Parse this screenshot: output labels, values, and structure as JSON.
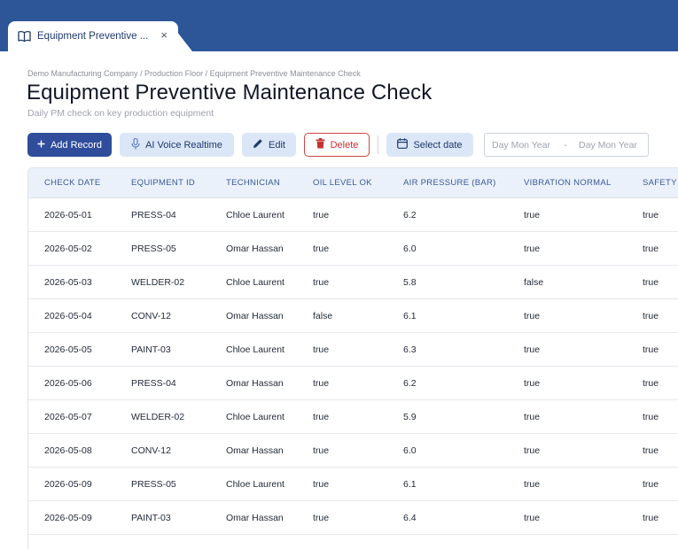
{
  "tab": {
    "title": "Equipment Preventive ...",
    "close": "×"
  },
  "breadcrumb": "Demo Manufacturing Company / Production Floor / Equipment Preventive Maintenance Check",
  "page": {
    "title": "Equipment Preventive Maintenance Check",
    "subtitle": "Daily PM check on key production equipment"
  },
  "toolbar": {
    "add_label": "Add Record",
    "voice_label": "AI Voice Realtime",
    "edit_label": "Edit",
    "delete_label": "Delete",
    "date_label": "Select date",
    "date_start_placeholder": "Day Mon Year",
    "date_dash": "-",
    "date_end_placeholder": "Day Mon Year"
  },
  "colors": {
    "header_blue": "#2d5698",
    "primary_button": "#2f4d9a",
    "secondary_button": "#dbe6f6",
    "delete_red": "#c53030"
  },
  "icons": {
    "tab": "book-icon",
    "add": "plus-icon",
    "voice": "microphone-icon",
    "edit": "pencil-icon",
    "delete": "trash-icon",
    "date": "calendar-icon"
  },
  "table": {
    "columns": [
      "CHECK DATE",
      "EQUIPMENT ID",
      "TECHNICIAN",
      "OIL LEVEL OK",
      "AIR PRESSURE (BAR)",
      "VIBRATION NORMAL",
      "SAFETY"
    ],
    "rows": [
      [
        "2026-05-01",
        "PRESS-04",
        "Chloe Laurent",
        "true",
        "6.2",
        "true",
        "true"
      ],
      [
        "2026-05-02",
        "PRESS-05",
        "Omar Hassan",
        "true",
        "6.0",
        "true",
        "true"
      ],
      [
        "2026-05-03",
        "WELDER-02",
        "Chloe Laurent",
        "true",
        "5.8",
        "false",
        "true"
      ],
      [
        "2026-05-04",
        "CONV-12",
        "Omar Hassan",
        "false",
        "6.1",
        "true",
        "true"
      ],
      [
        "2026-05-05",
        "PAINT-03",
        "Chloe Laurent",
        "true",
        "6.3",
        "true",
        "true"
      ],
      [
        "2026-05-06",
        "PRESS-04",
        "Omar Hassan",
        "true",
        "6.2",
        "true",
        "true"
      ],
      [
        "2026-05-07",
        "WELDER-02",
        "Chloe Laurent",
        "true",
        "5.9",
        "true",
        "true"
      ],
      [
        "2026-05-08",
        "CONV-12",
        "Omar Hassan",
        "true",
        "6.0",
        "true",
        "true"
      ],
      [
        "2026-05-09",
        "PRESS-05",
        "Chloe Laurent",
        "true",
        "6.1",
        "true",
        "true"
      ],
      [
        "2026-05-09",
        "PAINT-03",
        "Omar Hassan",
        "true",
        "6.4",
        "true",
        "true"
      ]
    ]
  }
}
